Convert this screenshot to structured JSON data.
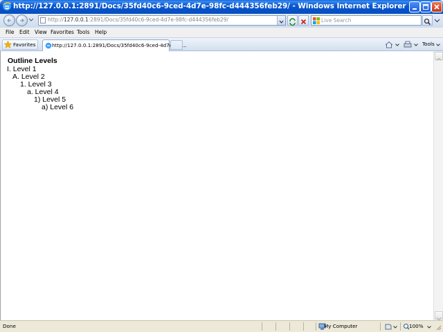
{
  "window": {
    "title": "http://127.0.0.1:2891/Docs/35fd40c6-9ced-4d7e-98fc-d444356feb29/ - Windows Internet Explorer"
  },
  "address": {
    "url_prefix": "http://",
    "url_host": "127.0.0.1",
    "url_rest": ":2891/Docs/35fd40c6-9ced-4d7e-98fc-d444356feb29/"
  },
  "search": {
    "placeholder": "Live Search"
  },
  "menu": [
    "File",
    "Edit",
    "View",
    "Favorites",
    "Tools",
    "Help"
  ],
  "tabs": {
    "favorites_label": "Favorites",
    "active_tab_label": "http://127.0.0.1:2891/Docs/35fd40c6-9ced-4d7e-98f..."
  },
  "toolbar": {
    "tools_label": "Tools"
  },
  "document": {
    "heading": "Outline Levels",
    "levels": [
      "I. Level 1",
      "A. Level 2",
      "1. Level 3",
      "a. Level 4",
      "1) Level 5",
      "a) Level 6"
    ]
  },
  "status": {
    "left": "Done",
    "zone": "My Computer",
    "zoom": "100%"
  },
  "colors": {
    "titlebar": "#0a58d0",
    "chrome": "#ece9d8",
    "content_bg": "#ffffff"
  }
}
